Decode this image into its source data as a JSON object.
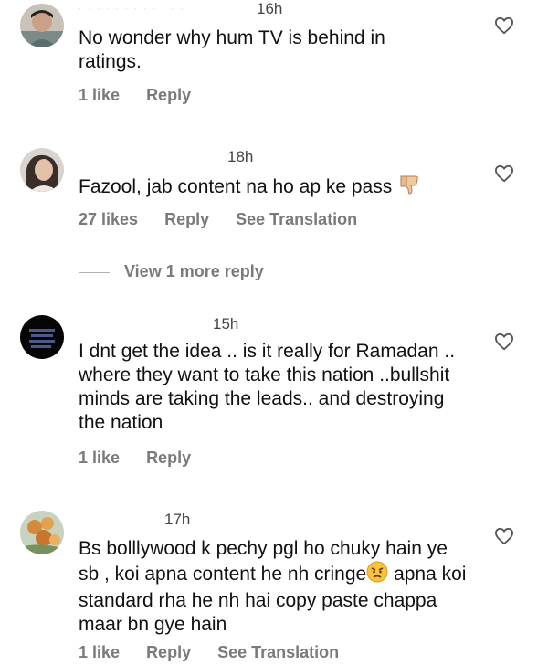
{
  "comments": [
    {
      "time": "16h",
      "text": "No wonder why hum TV is behind in ratings.",
      "actions": {
        "likes": "1 like",
        "reply": "Reply"
      }
    },
    {
      "time": "18h",
      "text": "Fazool, jab content na ho ap ke pass",
      "emoji": "thumbs-down",
      "actions": {
        "likes": "27 likes",
        "reply": "Reply",
        "translate": "See Translation"
      },
      "view_more": "View 1 more reply"
    },
    {
      "time": "15h",
      "text": "I dnt get the idea .. is it really for Ramadan .. where they want to take this nation ..bullshit minds are taking the leads.. and destroying the nation",
      "actions": {
        "likes": "1 like",
        "reply": "Reply"
      }
    },
    {
      "time": "17h",
      "text": "Bs bolllywood k pechy pgl ho chuky hain ye sb , koi apna content he nh cringe",
      "text_after_emoji": "apna koi standard rha he nh hai copy paste chappa maar bn gye hain",
      "emoji": "angry-face",
      "actions": {
        "likes": "1 like",
        "reply": "Reply",
        "translate": "See Translation"
      }
    }
  ],
  "icons": {
    "like": "heart-outline-icon"
  },
  "colors": {
    "meta": "#7a7a7a",
    "text": "#111111"
  }
}
